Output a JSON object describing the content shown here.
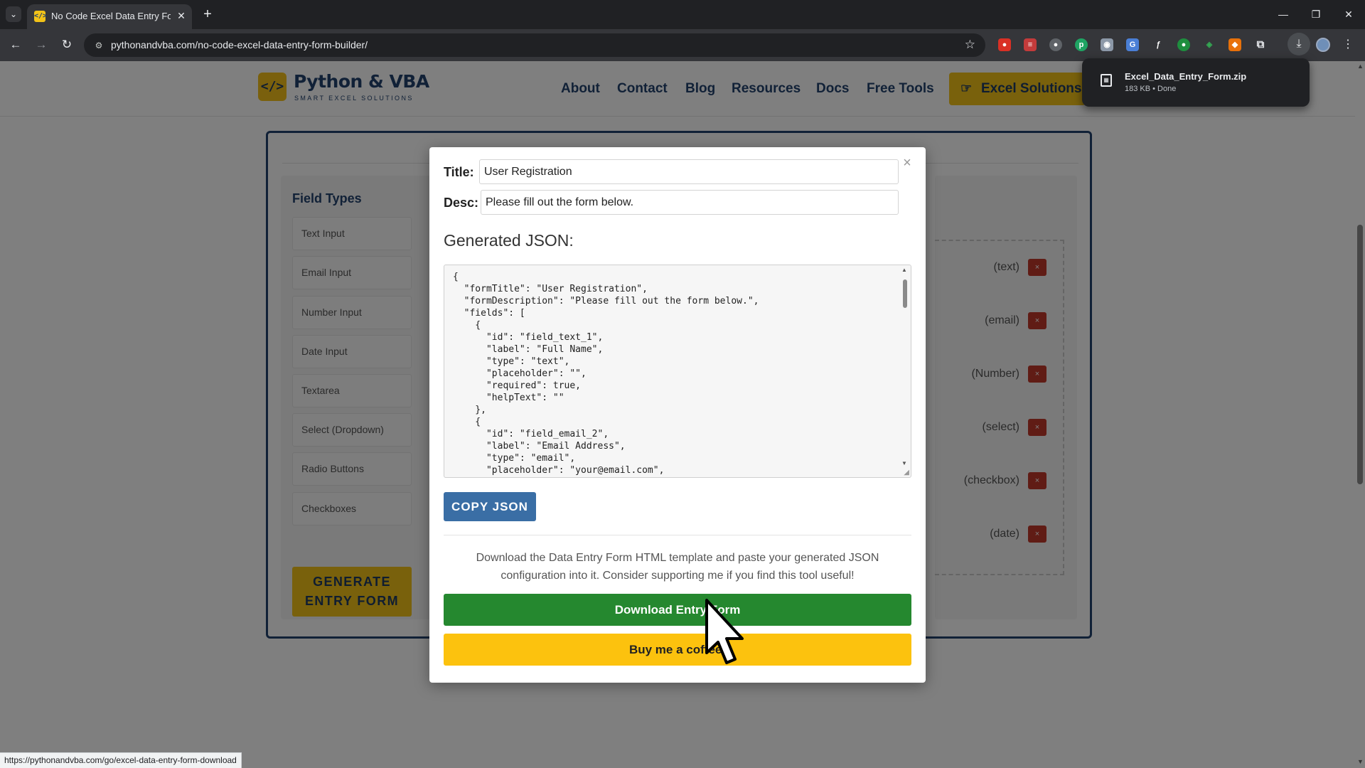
{
  "browser": {
    "tab": {
      "title": "No Code Excel Data Entry Form",
      "favicon": "</>"
    },
    "url": "pythonandvba.com/no-code-excel-data-entry-form-builder/",
    "status_url": "https://pythonandvba.com/go/excel-data-entry-form-download",
    "download": {
      "filename": "Excel_Data_Entry_Form.zip",
      "meta": "183 KB • Done"
    }
  },
  "header": {
    "logo": {
      "mark": "</>",
      "name": "Python & VBA",
      "tagline": "SMART EXCEL SOLUTIONS"
    },
    "nav": [
      "About",
      "Contact",
      "Blog",
      "Resources",
      "Docs",
      "Free Tools"
    ],
    "cta": "Excel Solutions"
  },
  "builder": {
    "field_types_title": "Field Types",
    "field_types": [
      "Text Input",
      "Email Input",
      "Number Input",
      "Date Input",
      "Textarea",
      "Select (Dropdown)",
      "Radio Buttons",
      "Checkboxes"
    ],
    "generate_label": "GENERATE ENTRY FORM",
    "preview_types": [
      "(text)",
      "(email)",
      "(Number)",
      "(select)",
      "(checkbox)",
      "(date)"
    ],
    "delete_symbol": "×"
  },
  "modal": {
    "close_symbol": "×",
    "title_label": "Title:",
    "title_value": "User Registration",
    "desc_label": "Desc:",
    "desc_value": "Please fill out the form below.",
    "json_heading": "Generated JSON:",
    "json_text": "{\n  \"formTitle\": \"User Registration\",\n  \"formDescription\": \"Please fill out the form below.\",\n  \"fields\": [\n    {\n      \"id\": \"field_text_1\",\n      \"label\": \"Full Name\",\n      \"type\": \"text\",\n      \"placeholder\": \"\",\n      \"required\": true,\n      \"helpText\": \"\"\n    },\n    {\n      \"id\": \"field_email_2\",\n      \"label\": \"Email Address\",\n      \"type\": \"email\",\n      \"placeholder\": \"your@email.com\",",
    "copy_label": "COPY JSON",
    "note": "Download the Data Entry Form HTML template and paste your generated JSON configuration into it. Consider supporting me if you find this tool useful!",
    "download_label": "Download Entry Form",
    "coffee_label": "Buy me a coffee!"
  },
  "colors": {
    "brand_navy": "#23426e",
    "brand_yellow": "#f2c218",
    "download_green": "#25882f",
    "copy_blue": "#3a6ea5",
    "delete_red": "#c0392b"
  },
  "icons": [
    "tab-list-icon",
    "close-icon",
    "new-tab-icon",
    "back-icon",
    "forward-icon",
    "reload-icon",
    "site-info-icon",
    "bookmark-star-icon",
    "extensions-icon",
    "download-icon",
    "menu-icon",
    "file-icon",
    "hand-icon",
    "cursor-icon"
  ]
}
